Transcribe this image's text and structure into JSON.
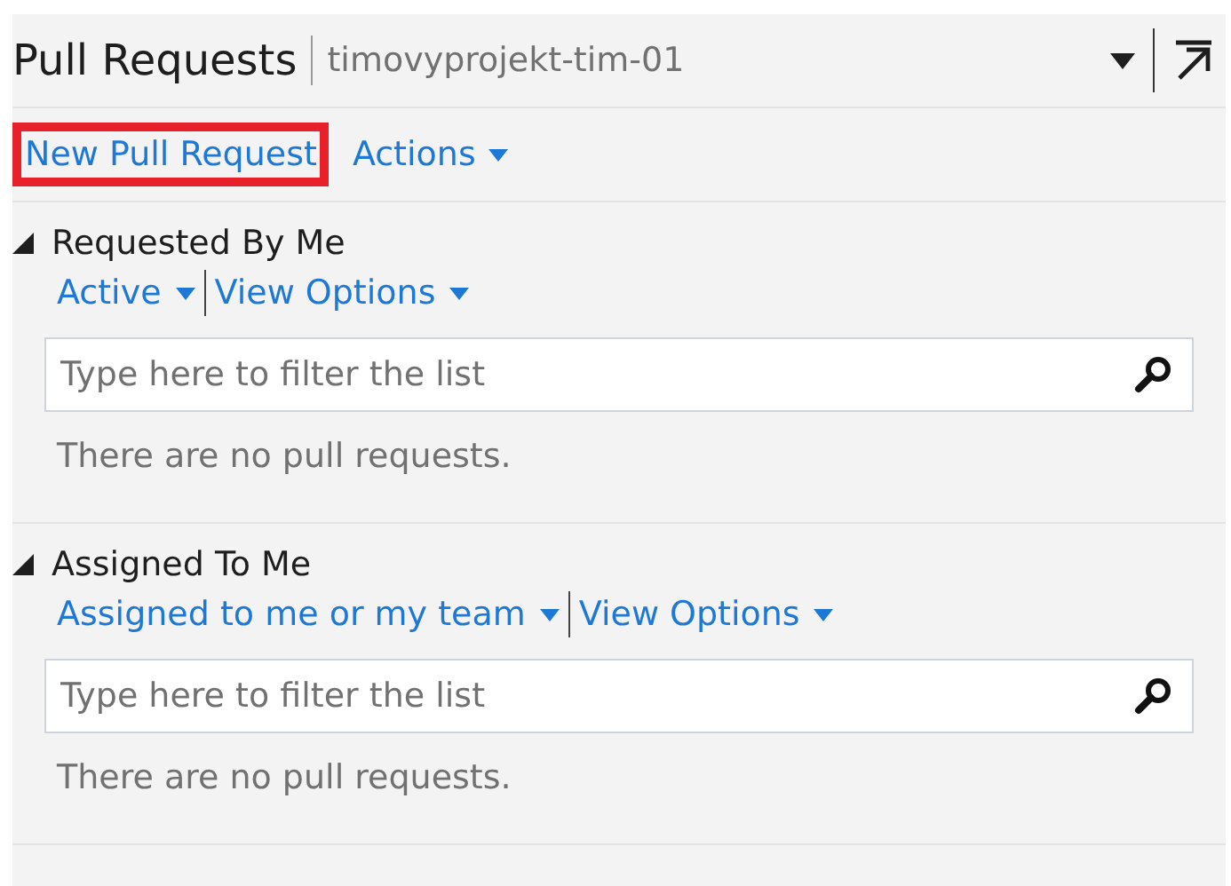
{
  "header": {
    "title": "Pull Requests",
    "subtitle": "timovyprojekt-tim-01"
  },
  "toolbar": [
    {
      "label": "New Pull Request",
      "highlighted": true,
      "dropdown": false
    },
    {
      "label": "Actions",
      "highlighted": false,
      "dropdown": true
    }
  ],
  "sections": [
    {
      "title": "Requested By Me",
      "expanded": true,
      "filters": [
        "Active",
        "View Options"
      ],
      "search": {
        "placeholder": "Type here to filter the list"
      },
      "empty_message": "There are no pull requests."
    },
    {
      "title": "Assigned To Me",
      "expanded": true,
      "filters": [
        "Assigned to me or my team",
        "View Options"
      ],
      "search": {
        "placeholder": "Type here to filter the list"
      },
      "empty_message": "There are no pull requests."
    }
  ]
}
